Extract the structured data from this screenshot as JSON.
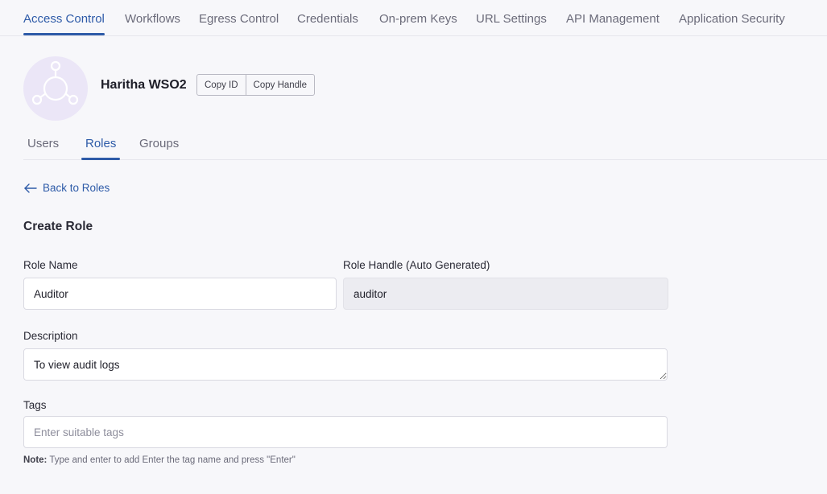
{
  "top_tabs": [
    {
      "label": "Access Control",
      "active": true
    },
    {
      "label": "Workflows"
    },
    {
      "label": "Egress Control"
    },
    {
      "label": "Credentials"
    },
    {
      "label": "On-prem Keys"
    },
    {
      "label": "URL Settings"
    },
    {
      "label": "API Management"
    },
    {
      "label": "Application Security"
    }
  ],
  "org": {
    "name": "Haritha WSO2",
    "avatar_icon": "network-nodes-icon",
    "copy_id_label": "Copy ID",
    "copy_handle_label": "Copy Handle"
  },
  "sub_tabs": [
    {
      "label": "Users"
    },
    {
      "label": "Roles",
      "active": true
    },
    {
      "label": "Groups"
    }
  ],
  "back_link": {
    "label": "Back to Roles",
    "icon": "arrow-left-icon"
  },
  "form": {
    "title": "Create Role",
    "role_name": {
      "label": "Role Name",
      "value": "Auditor"
    },
    "role_handle": {
      "label": "Role Handle (Auto Generated)",
      "value": "auditor"
    },
    "description": {
      "label": "Description",
      "value": "To view audit logs"
    },
    "tags": {
      "label": "Tags",
      "placeholder": "Enter suitable tags",
      "value": ""
    },
    "note": {
      "prefix": "Note:",
      "text": "Type and enter to add Enter the tag name and press \"Enter\""
    }
  },
  "colors": {
    "accent": "#2e5ba8",
    "avatar_bg": "#ebe6f7",
    "page_bg": "#f7f7fa"
  }
}
